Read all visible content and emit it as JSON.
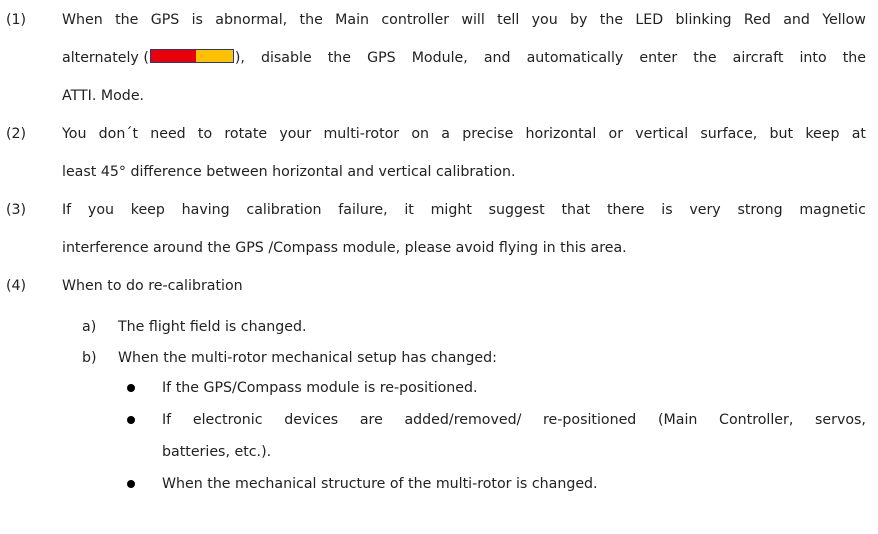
{
  "items": [
    {
      "num": "(1)",
      "line1": "When the GPS is abnormal, the Main controller will tell you by the LED blinking Red and Yellow",
      "line2_before": "alternately (",
      "line2_after": "), disable the GPS Module, and automatically enter the aircraft into the",
      "line3": "ATTI. Mode."
    },
    {
      "num": "(2)",
      "line1": "You don´t need to rotate your multi-rotor on a precise horizontal or vertical surface, but keep at",
      "line2": "least 45° difference between horizontal and vertical calibration."
    },
    {
      "num": "(3)",
      "line1": "If you keep having calibration failure, it might suggest that there is very strong magnetic",
      "line2": "interference around the GPS /Compass module, please avoid flying in this area."
    },
    {
      "num": "(4)",
      "line1": "When to do re-calibration"
    }
  ],
  "sub_items": [
    {
      "letter": "a)",
      "text": "The flight field is changed."
    },
    {
      "letter": "b)",
      "text": "When the multi-rotor mechanical setup has changed:"
    }
  ],
  "bullets": [
    {
      "line1": "If the GPS/Compass module is re-positioned."
    },
    {
      "line1": "If electronic devices are added/removed/ re-positioned (Main Controller, servos,",
      "line2": "batteries, etc.)."
    },
    {
      "line1": "When the mechanical structure of the multi-rotor is changed."
    }
  ],
  "led_colors": {
    "red": "#e8000b",
    "yellow": "#ffc000",
    "border": "#1a3a9c"
  }
}
